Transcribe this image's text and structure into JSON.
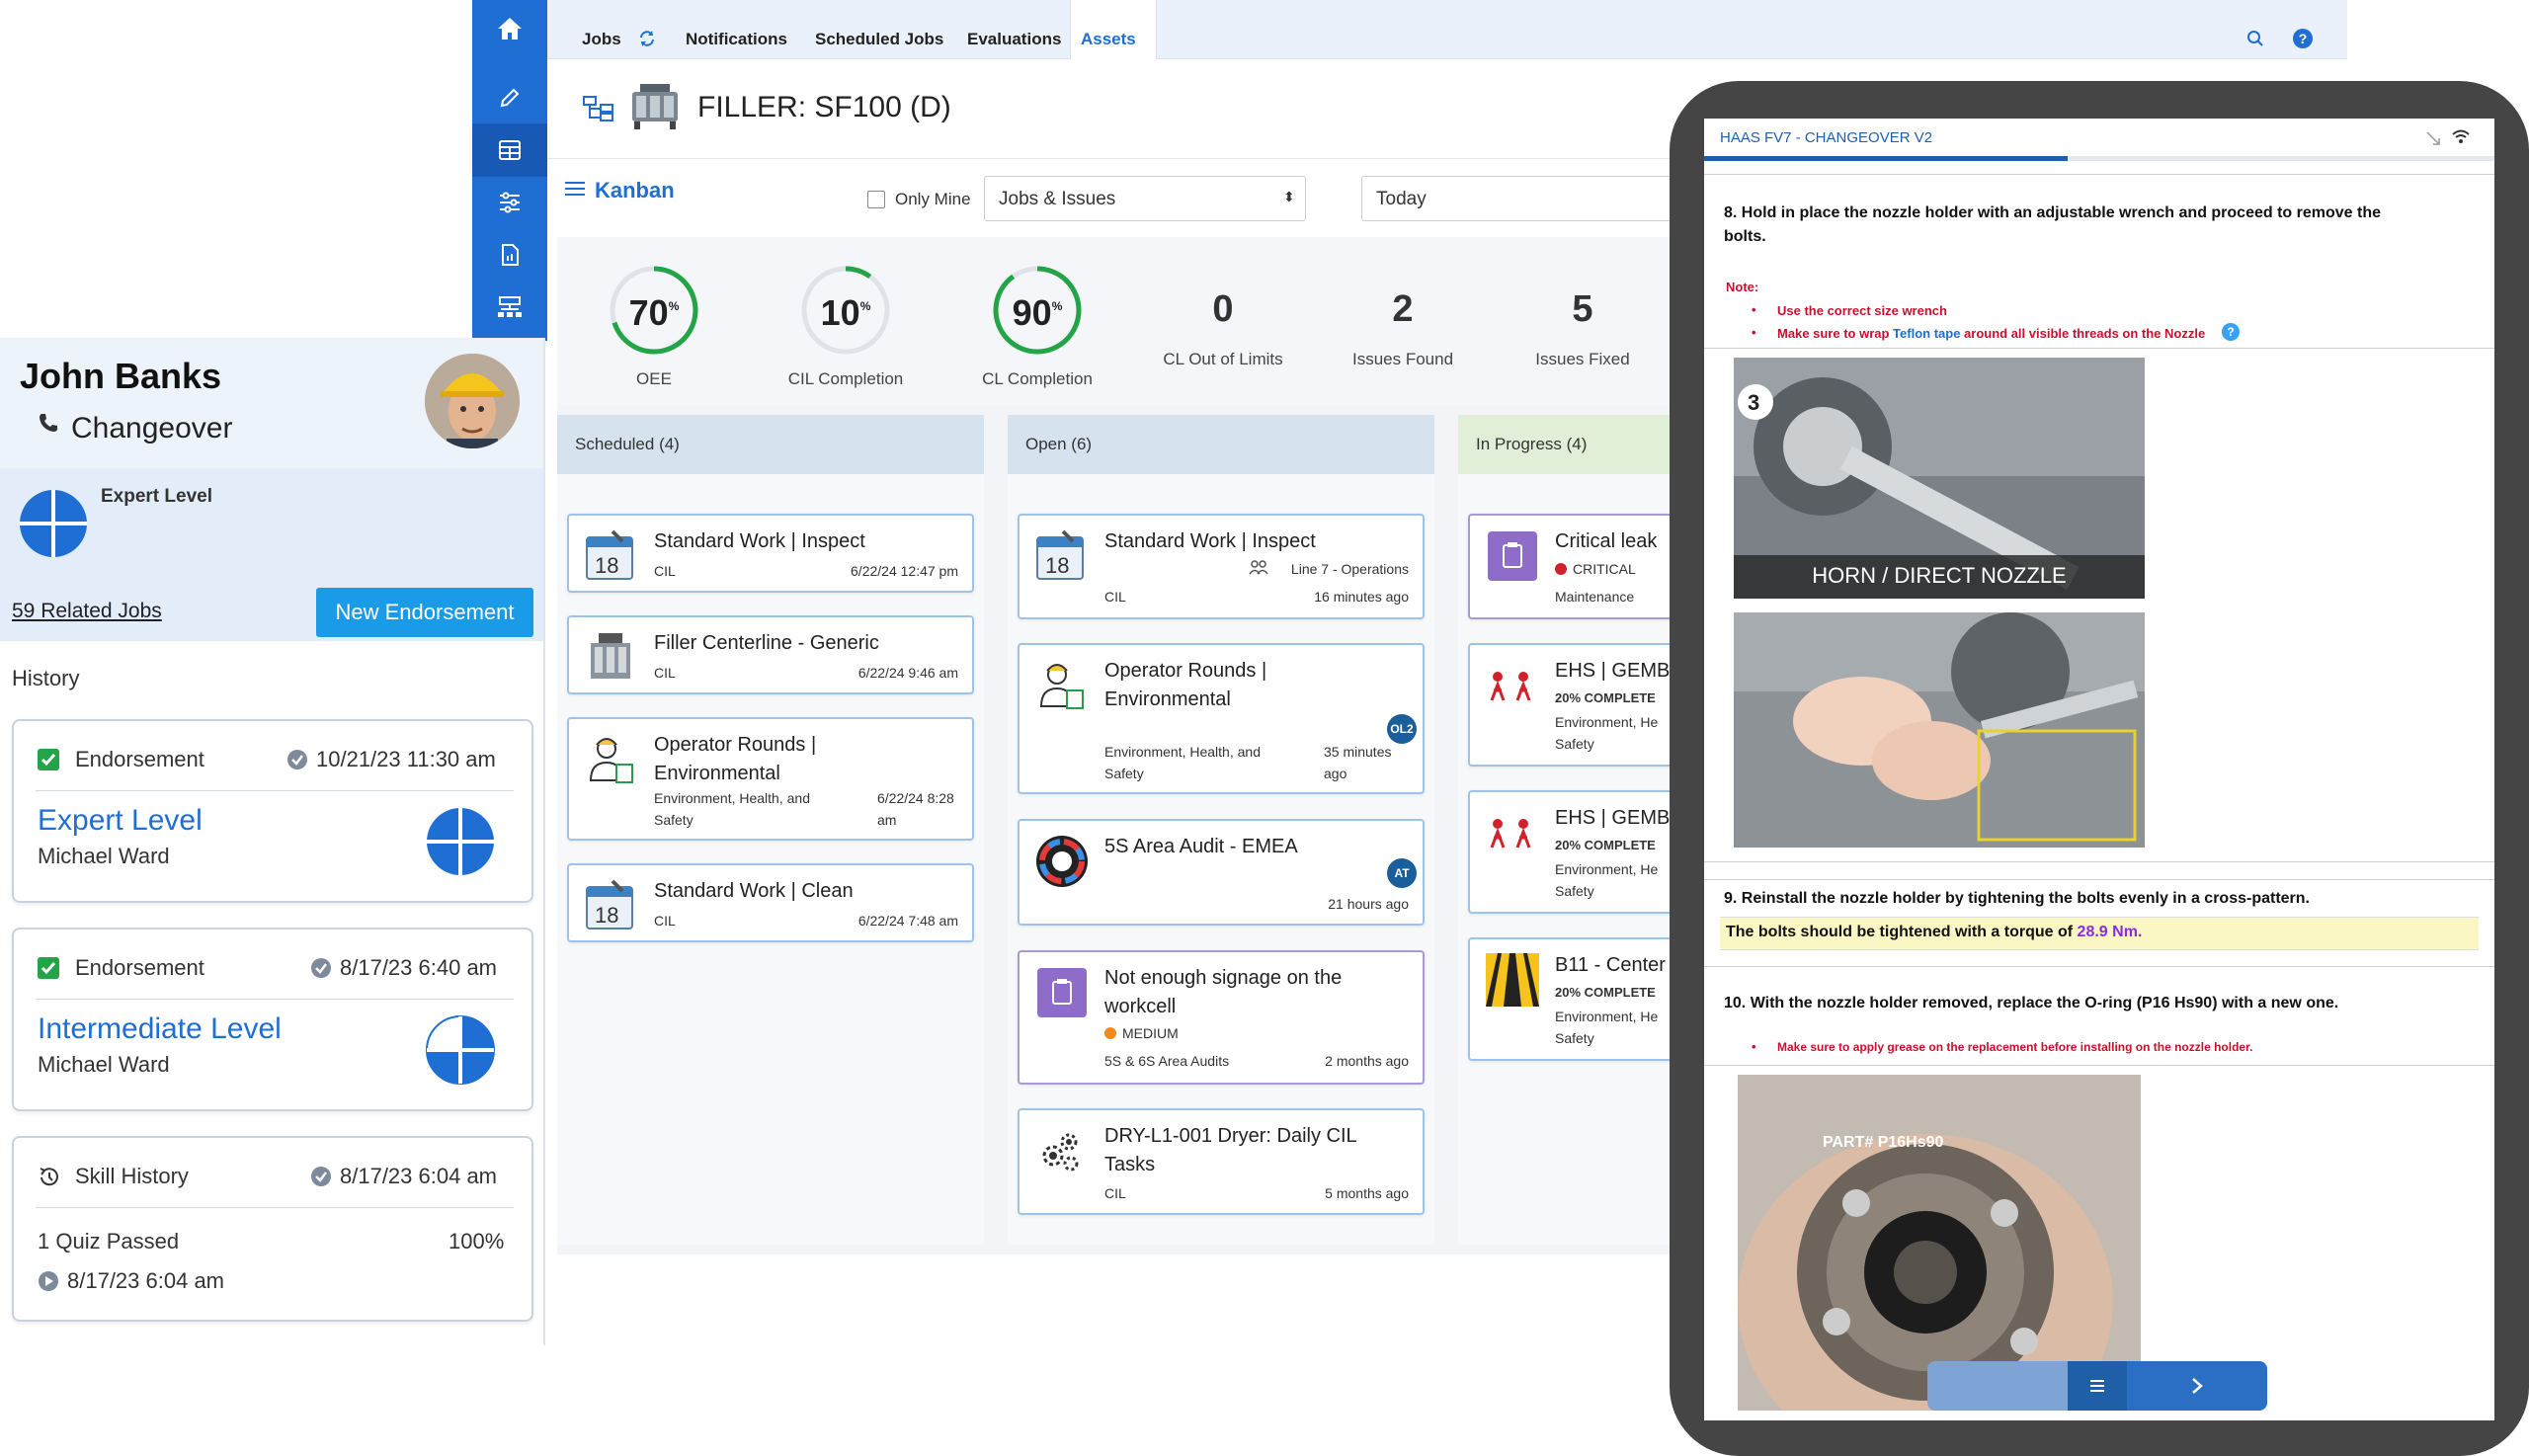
{
  "nav": {
    "items": [
      "home-icon",
      "pencil-icon",
      "table-icon",
      "sliders-icon",
      "report-icon",
      "org-icon"
    ]
  },
  "topbar": {
    "tabs": [
      "Jobs",
      "Notifications",
      "Scheduled Jobs",
      "Evaluations",
      "Assets"
    ],
    "active_tab": "Assets"
  },
  "asset": {
    "title": "FILLER: SF100 (D)"
  },
  "kanban": {
    "label": "Kanban",
    "only_mine_label": "Only Mine",
    "filter_value": "Jobs & Issues",
    "date_value": "Today"
  },
  "metrics": [
    {
      "value": "70",
      "unit": "%",
      "label": "OEE",
      "percent": 70
    },
    {
      "value": "10",
      "unit": "%",
      "label": "CIL Completion",
      "percent": 10
    },
    {
      "value": "90",
      "unit": "%",
      "label": "CL Completion",
      "percent": 90
    },
    {
      "value": "0",
      "label": "CL Out of Limits"
    },
    {
      "value": "2",
      "label": "Issues Found"
    },
    {
      "value": "5",
      "label": "Issues Fixed"
    }
  ],
  "columns": {
    "scheduled": {
      "header": "Scheduled (4)",
      "cards": [
        {
          "title": "Standard Work | Inspect",
          "tag": "CIL",
          "time": "6/22/24 12:47 pm"
        },
        {
          "title": "Filler Centerline - Generic",
          "tag": "CIL",
          "time": "6/22/24 9:46 am"
        },
        {
          "title_line1": "Operator Rounds |",
          "title_line2": "Environmental",
          "tag_line1": "Environment, Health, and",
          "tag_line2": "Safety",
          "time_line1": "6/22/24 8:28",
          "time_line2": "am"
        },
        {
          "title": "Standard Work | Clean",
          "tag": "CIL",
          "time": "6/22/24 7:48 am"
        }
      ]
    },
    "open": {
      "header": "Open (6)",
      "cards": [
        {
          "title": "Standard Work | Inspect",
          "location": "Line 7 - Operations",
          "tag": "CIL",
          "time": "16 minutes ago"
        },
        {
          "title_line1": "Operator Rounds |",
          "title_line2": "Environmental",
          "badge": "OL2",
          "tag_line1": "Environment, Health, and",
          "tag_line2": "Safety",
          "time_line1": "35 minutes",
          "time_line2": "ago"
        },
        {
          "title": "5S Area Audit - EMEA",
          "badge": "AT",
          "time": "21 hours ago"
        },
        {
          "title_line1": "Not enough signage on the",
          "title_line2": "workcell",
          "severity": "MEDIUM",
          "tag": "5S & 6S Area Audits",
          "time": "2 months ago"
        },
        {
          "title_line1": "DRY-L1-001 Dryer: Daily CIL",
          "title_line2": "Tasks",
          "tag": "CIL",
          "time": "5 months ago"
        }
      ]
    },
    "in_progress": {
      "header": "In Progress (4)",
      "cards": [
        {
          "title": "Critical leak",
          "severity": "CRITICAL",
          "tag": "Maintenance"
        },
        {
          "title": "EHS | GEMBA",
          "progress": "20% COMPLETE",
          "tag_line1": "Environment, He",
          "tag_line2": "Safety"
        },
        {
          "title": "EHS | GEMBA",
          "progress": "20% COMPLETE",
          "tag_line1": "Environment, He",
          "tag_line2": "Safety"
        },
        {
          "title": "B11 - Center",
          "progress": "20% COMPLETE",
          "tag_line1": "Environment, He",
          "tag_line2": "Safety"
        }
      ]
    }
  },
  "profile": {
    "name": "John Banks",
    "role": "Changeover",
    "level": "Expert Level",
    "related_jobs": "59 Related Jobs",
    "new_endorsement": "New Endorsement",
    "history_label": "History"
  },
  "history": [
    {
      "type": "Endorsement",
      "date": "10/21/23 11:30 am",
      "level": "Expert Level",
      "by": "Michael Ward"
    },
    {
      "type": "Endorsement",
      "date": "8/17/23 6:40 am",
      "level": "Intermediate Level",
      "by": "Michael Ward"
    },
    {
      "type": "Skill History",
      "date": "8/17/23 6:04 am",
      "quiz": "1 Quiz Passed",
      "score": "100%",
      "sub_date": "8/17/23 6:04 am"
    }
  ],
  "tablet": {
    "title": "HAAS FV7 - CHANGEOVER V2",
    "step8_line1": "8. Hold in place the nozzle holder with an adjustable wrench and proceed to remove the",
    "step8_line2": "bolts.",
    "note_label": "Note:",
    "note1": "Use the correct size wrench",
    "note2_a": "Make sure to wrap ",
    "note2_link": "Teflon tape",
    "note2_b": " around all visible threads on the Nozzle",
    "image1_caption": "HORN / DIRECT NOZZLE",
    "step9": "9. Reinstall the nozzle holder by tightening the bolts evenly in a cross-pattern.",
    "torque_a": "The bolts should be tightened with a torque of ",
    "torque_value": "28.9 Nm.",
    "step10": "10. With the nozzle holder removed, replace the O-ring (P16 Hs90) with a new one.",
    "note3": "Make sure to apply grease on the replacement before installing on the nozzle holder.",
    "image3_caption": "PART# P16Hs90"
  },
  "colors": {
    "primary": "#1f6ed4",
    "green": "#22a447",
    "critical": "#d0212c",
    "medium": "#f08a1c",
    "purple": "#8e6cc9"
  }
}
